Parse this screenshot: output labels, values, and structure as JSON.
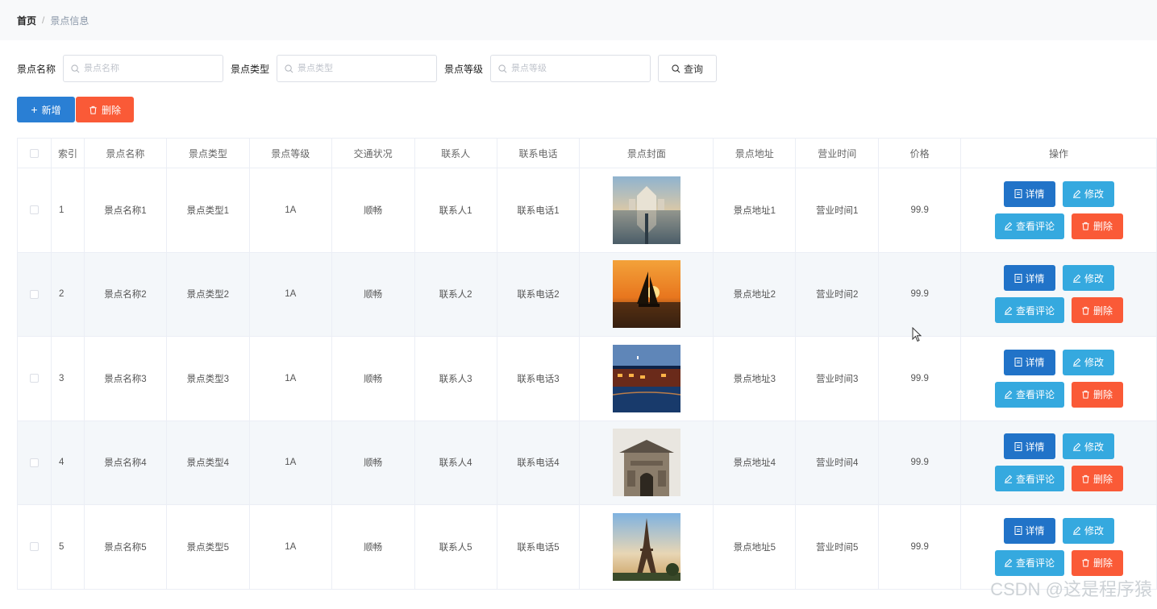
{
  "breadcrumb": {
    "home": "首页",
    "separator": "/",
    "current": "景点信息"
  },
  "search": {
    "fields": [
      {
        "label": "景点名称",
        "placeholder": "景点名称",
        "value": ""
      },
      {
        "label": "景点类型",
        "placeholder": "景点类型",
        "value": ""
      },
      {
        "label": "景点等级",
        "placeholder": "景点等级",
        "value": ""
      }
    ],
    "button_label": "查询"
  },
  "actions": {
    "add_label": "新增",
    "delete_label": "删除"
  },
  "table": {
    "columns": [
      "索引",
      "景点名称",
      "景点类型",
      "景点等级",
      "交通状况",
      "联系人",
      "联系电话",
      "景点封面",
      "景点地址",
      "营业时间",
      "价格",
      "操作"
    ],
    "rows": [
      {
        "index": "1",
        "name": "景点名称1",
        "type": "景点类型1",
        "level": "1A",
        "traffic": "顺畅",
        "contact": "联系人1",
        "phone": "联系电话1",
        "cover": "palace-reflection",
        "address": "景点地址1",
        "hours": "营业时间1",
        "price": "99.9"
      },
      {
        "index": "2",
        "name": "景点名称2",
        "type": "景点类型2",
        "level": "1A",
        "traffic": "顺畅",
        "contact": "联系人2",
        "phone": "联系电话2",
        "cover": "sailboat-sunset",
        "address": "景点地址2",
        "hours": "营业时间2",
        "price": "99.9"
      },
      {
        "index": "3",
        "name": "景点名称3",
        "type": "景点类型3",
        "level": "1A",
        "traffic": "顺畅",
        "contact": "联系人3",
        "phone": "联系电话3",
        "cover": "water-town-night",
        "address": "景点地址3",
        "hours": "营业时间3",
        "price": "99.9"
      },
      {
        "index": "4",
        "name": "景点名称4",
        "type": "景点类型4",
        "level": "1A",
        "traffic": "顺畅",
        "contact": "联系人4",
        "phone": "联系电话4",
        "cover": "ancient-gate",
        "address": "景点地址4",
        "hours": "营业时间4",
        "price": "99.9"
      },
      {
        "index": "5",
        "name": "景点名称5",
        "type": "景点类型5",
        "level": "1A",
        "traffic": "顺畅",
        "contact": "联系人5",
        "phone": "联系电话5",
        "cover": "eiffel-tower",
        "address": "景点地址5",
        "hours": "营业时间5",
        "price": "99.9"
      }
    ],
    "row_actions": {
      "detail": "详情",
      "edit": "修改",
      "review": "查看评论",
      "delete": "删除"
    }
  },
  "watermark": "CSDN @这是程序猿",
  "colors": {
    "primary": "#2a7fd4",
    "info": "#35a9df",
    "danger": "#fa5a37",
    "stripe": "#f4f7fa"
  }
}
